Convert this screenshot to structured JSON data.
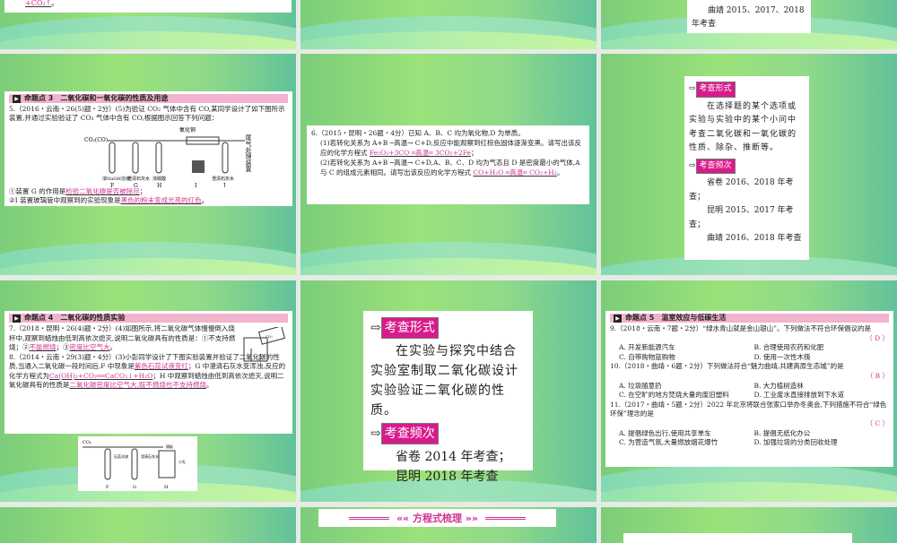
{
  "s0c1": {
    "tail": "+CO₂↑",
    "end": "。"
  },
  "s0c3": {
    "line1": "曲靖 2015、2017、2018",
    "line2": "年考查"
  },
  "s1c1": {
    "header": "命题点 3　二氧化碳和一氧化碳的性质及用途",
    "q": "5.（2016・云南・26(5)题・2分）(5)为验证 CO₂ 气体中含有 CO,某同学设计了如下图所示装置,并通过实验验证了 CO₂ 气体中含有 CO,根据图示回答下列问题：",
    "diagram": {
      "gas": "CO₂(CO)",
      "cuo": "氧化铜",
      "tail": "尾气处理装置",
      "reagents": [
        "浓NaOH溶液",
        "澄清石灰水",
        "浓硫酸",
        "",
        "澄清石灰水"
      ],
      "labels": [
        "F",
        "G",
        "H",
        "I",
        "J"
      ]
    },
    "a1_pre": "①装置 G 的作用是",
    "a1": "检验二氧化碳是否被除尽",
    "a1_end": "；",
    "a2_pre": "②I 装置玻璃管中观察到的实验现象是",
    "a2": "黑色的粉末变成光亮的红色",
    "a2_end": "。"
  },
  "s1c2": {
    "q": "6.（2015・昆明・26题・4分）已知 A、B、C 均为氧化物,D 为单质。",
    "p1": "(1)若转化关系为 A+B ─高温→ C+D,反应中能观察到红棕色固体逐渐变黑。请写出该反应的化学方程式",
    "a1": "Fe₂O₃+3CO ═高温═ 3CO₂+2Fe",
    "p2": "(2)若转化关系为 A+B ─高温→ C+D,A、B、C、D 均为气态且 D 是密度最小的气体,A 与 C 的组成元素相同。请写出该反应的化学方程式",
    "a2": "CO+H₂O ═高温═ CO₂+H₂"
  },
  "s1c3": {
    "tag1": "考查形式",
    "body": "在选择题的某个选项或实验与实验中的某个小问中考查二氧化碳和一氧化碳的性质、除杂、推断等。",
    "tag2": "考查频次",
    "f1": "省卷 2016、2018 年考查；",
    "f2": "昆明 2015、2017 年考查；",
    "f3": "曲靖 2016、2018 年考查"
  },
  "s2c1": {
    "header": "命题点 4　二氧化碳的性质实验",
    "q7": "7.（2018・昆明・26(4)题・2分）(4)如图所示,将二氧化碳气体慢慢倒入烧杯中,观察到蜡烛由低到高依次熄灭,说明二氧化碳具有的性质是：①不支持燃烧；②",
    "a7a": "不能燃烧",
    "m7": "；③",
    "a7b": "密度比空气大",
    "q8": "8.（2014・云南・29(3)题・4分）(3)小彭同学设计了下图实验装置并验证了二氧化碳的性质,当通入二氧化碳一段时间后,F 中现象是",
    "a8a": "紫色石蕊试液变红",
    "m8a": "；G 中澄清石灰水变浑浊,反应的化学方程式为",
    "a8b": "Ca(OH)₂+CO₂══CaCO₃↓+H₂O",
    "m8b": "；H 中观察到蜡烛由低到高依次熄灭,说明二氧化碳具有的性质是",
    "a8c": "二氧化碳密度比空气大,既不燃烧也不支持燃烧",
    "diagram": {
      "gas": "CO₂",
      "r1": "石蕊试液",
      "r2": "澄清石灰水",
      "r3": "隔板",
      "r4": "小孔",
      "labels": [
        "F",
        "G",
        "H"
      ],
      "co2": "CO₂"
    }
  },
  "s2c2": {
    "tag1": "考查形式",
    "body": "在实验与探究中结合实验室制取二氧化碳设计实验验证二氧化碳的性质。",
    "tag2": "考查频次",
    "f1": "省卷 2014 年考查；",
    "f2": "昆明 2018 年考查"
  },
  "s2c3": {
    "header": "命题点 5　温室效应与低碳生活",
    "q9": "9.（2018・云南・7题・2分）“绿水青山就是金山银山”。下列做法不符合环保倡议的是",
    "a9": "（ D ）",
    "o9": [
      "A. 开发新能源汽车",
      "B. 合理使用农药和化肥",
      "C. 自带购物篮购物",
      "D. 使用一次性木筷"
    ],
    "q10": "10.（2018・曲靖・6题・2分）下列做法符合“魅力曲靖,共建高原生态城”的是",
    "a10": "（ B ）",
    "o10": [
      "A. 垃圾随意扔",
      "B. 大力植树造林",
      "C. 在空旷的地方焚烧大量的废旧塑料",
      "D. 工业废水直接排放到下水道"
    ],
    "q11": "11.（2017・曲靖・5题・2分）2022 年北京将联合张家口举办冬奥会,下列措施不符合“绿色环保”理念的是",
    "a11": "（ C ）",
    "o11": [
      "A. 提倡绿色出行,使用共享单车",
      "B. 提倡无纸化办公",
      "C. 为营造气氛,大量燃放烟花爆竹",
      "D. 加强垃圾的分类回收处理"
    ]
  },
  "s3c2": {
    "title": "«« 方程式梳理 »»"
  }
}
